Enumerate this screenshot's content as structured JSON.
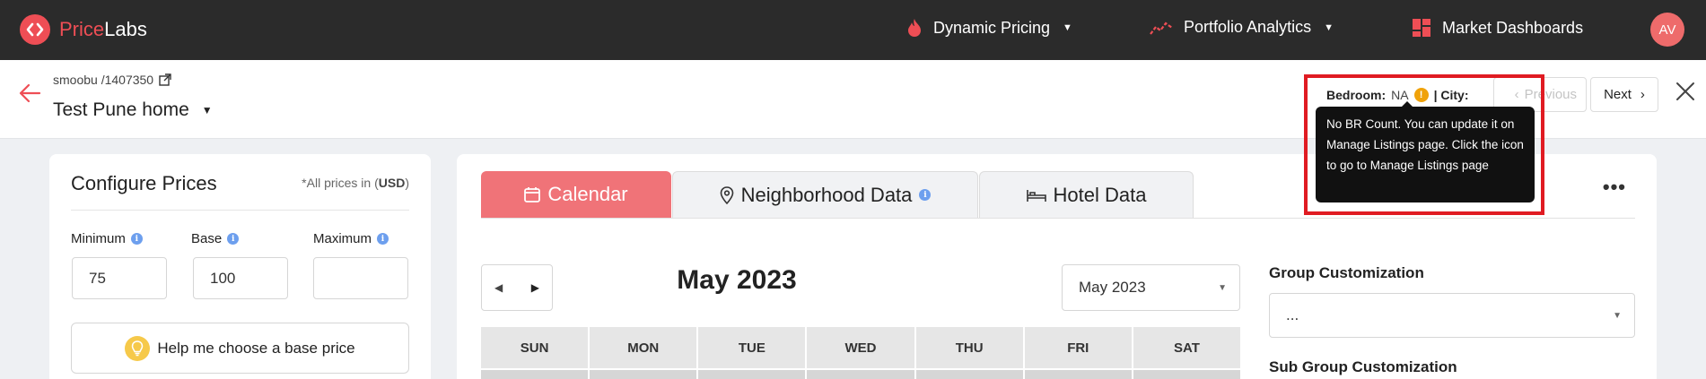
{
  "brand": {
    "name_a": "Price",
    "name_b": "Labs"
  },
  "nav": {
    "dynamic_pricing": "Dynamic Pricing",
    "portfolio_analytics": "Portfolio Analytics",
    "market_dashboards": "Market Dashboards",
    "avatar": "AV"
  },
  "listing": {
    "breadcrumb": "smoobu /1407350",
    "title": "Test Pune home",
    "bedroom_label": "Bedroom:",
    "bedroom_value": "NA",
    "city_label": "| City:",
    "tooltip": "No BR Count. You can update it on Manage Listings page. Click the icon to go to Manage Listings page",
    "prev_label": "Previous",
    "next_label": "Next"
  },
  "configure": {
    "title": "Configure Prices",
    "note_prefix": "*All prices in (",
    "currency": "USD",
    "note_suffix": ")",
    "min_label": "Minimum",
    "base_label": "Base",
    "max_label": "Maximum",
    "min_value": "75",
    "base_value": "100",
    "max_value": "",
    "help_button": "Help me choose a base price"
  },
  "tabs": {
    "calendar": "Calendar",
    "neighborhood": "Neighborhood Data",
    "hotel": "Hotel Data"
  },
  "calendar": {
    "month_title": "May 2023",
    "month_select": "May 2023",
    "weekdays": [
      "SUN",
      "MON",
      "TUE",
      "WED",
      "THU",
      "FRI",
      "SAT"
    ]
  },
  "customization": {
    "group_label": "Group Customization",
    "group_value": "...",
    "subgroup_label": "Sub Group Customization"
  },
  "colors": {
    "accent": "#ee4e55",
    "tab_active": "#f07378",
    "highlight_border": "#e01b22",
    "warning": "#f0a20a",
    "info": "#6d9fee"
  }
}
